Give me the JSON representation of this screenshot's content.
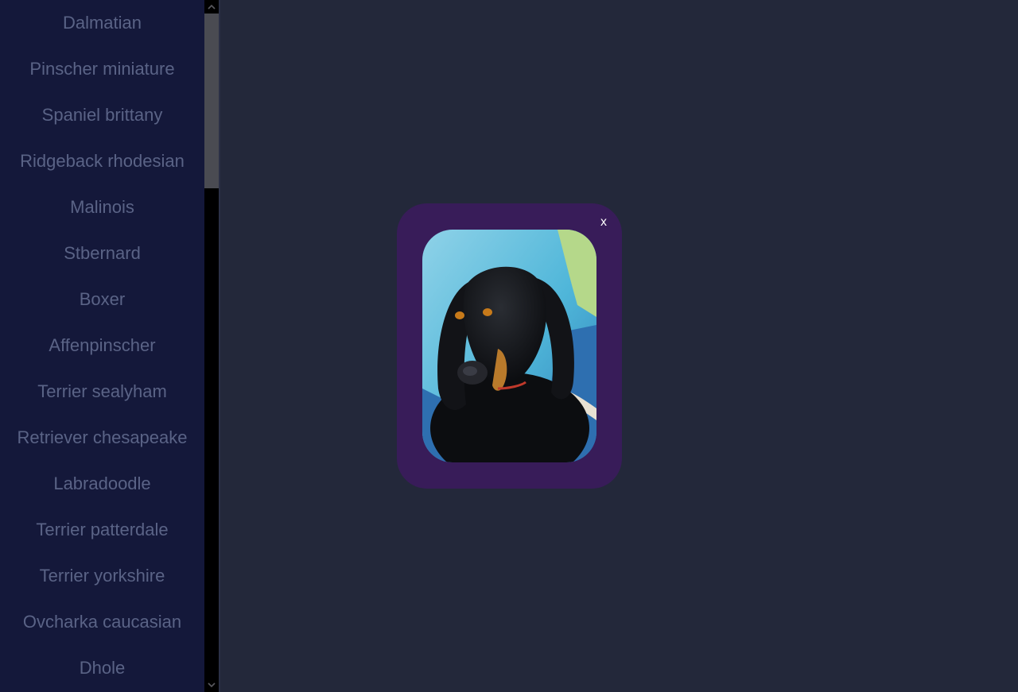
{
  "sidebar": {
    "items": [
      {
        "label": "Dalmatian"
      },
      {
        "label": "Pinscher miniature"
      },
      {
        "label": "Spaniel brittany"
      },
      {
        "label": "Ridgeback rhodesian"
      },
      {
        "label": "Malinois"
      },
      {
        "label": "Stbernard"
      },
      {
        "label": "Boxer"
      },
      {
        "label": "Affenpinscher"
      },
      {
        "label": "Terrier sealyham"
      },
      {
        "label": "Retriever chesapeake"
      },
      {
        "label": "Labradoodle"
      },
      {
        "label": "Terrier patterdale"
      },
      {
        "label": "Terrier yorkshire"
      },
      {
        "label": "Ovcharka caucasian"
      },
      {
        "label": "Dhole"
      }
    ]
  },
  "modal": {
    "close_label": "x",
    "image_subject": "black-and-tan-hound-photo"
  },
  "colors": {
    "page_bg": "#23283a",
    "sidebar_bg": "#14183a",
    "sidebar_text": "#5a6386",
    "modal_bg": "#381c59",
    "close_text": "#ffffff"
  }
}
